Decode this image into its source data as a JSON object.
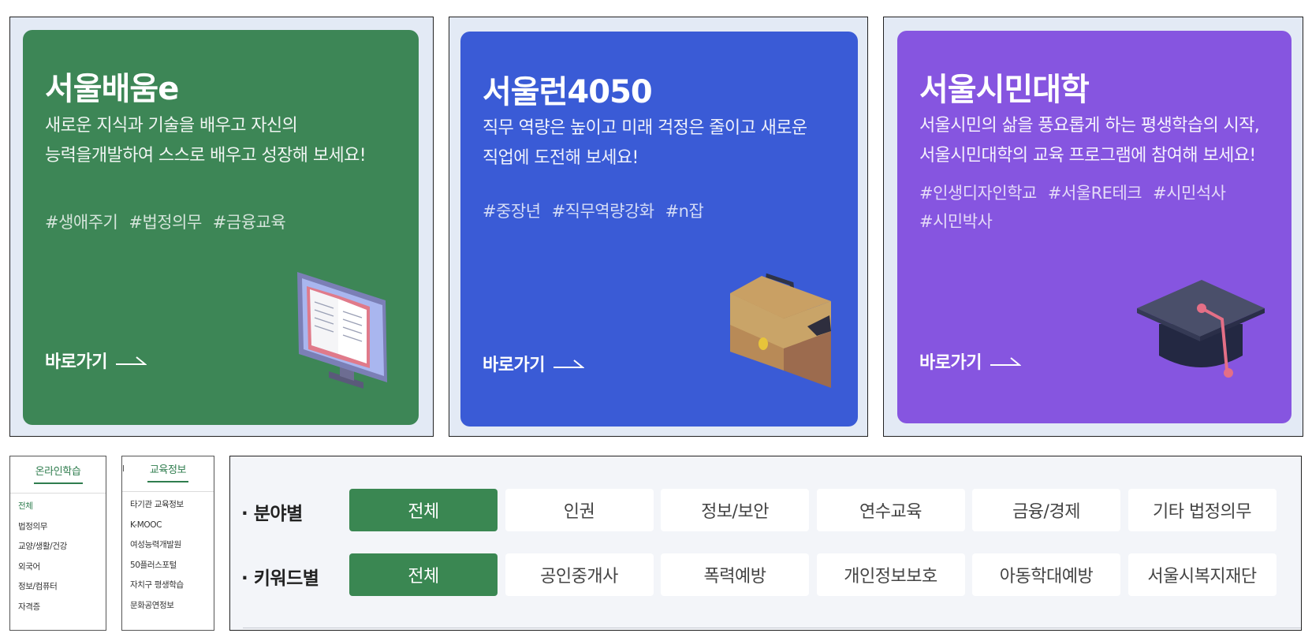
{
  "cards": [
    {
      "title": "서울배움e",
      "desc": [
        "새로운 지식과 기술을 배우고 자신의",
        "능력을개발하여 스스로 배우고 성장해 보세요!"
      ],
      "tags": [
        "#생애주기",
        "#법정의무",
        "#금융교육"
      ],
      "link": "바로가기",
      "illustration": "monitor-book-icon",
      "color": "#3d8656"
    },
    {
      "title": "서울런4050",
      "desc": [
        "직무 역량은 높이고 미래 걱정은 줄이고 새로운",
        "직업에 도전해 보세요!"
      ],
      "tags": [
        "#중장년",
        "#직무역량강화",
        "#n잡"
      ],
      "link": "바로가기",
      "illustration": "briefcase-icon",
      "color": "#3a5bd6"
    },
    {
      "title": "서울시민대학",
      "desc": [
        "서울시민의 삶을 풍요롭게 하는 평생학습의 시작,",
        "서울시민대학의 교육 프로그램에 참여해 보세요!"
      ],
      "tags": [
        "#인생디자인학교",
        "#서울RE테크",
        "#시민석사"
      ],
      "tags2": [
        "#시민박사"
      ],
      "link": "바로가기",
      "illustration": "graduation-cap-icon",
      "color": "#8655e0"
    }
  ],
  "menus": {
    "online": {
      "title": "온라인학습",
      "items": [
        "전체",
        "법정의무",
        "교양/생활/건강",
        "외국어",
        "정보/컴퓨터",
        "자격증"
      ],
      "active": "전체"
    },
    "edu": {
      "title": "교육정보",
      "items": [
        "타기관 교육정보",
        "K-MOOC",
        "여성능력개발원",
        "50플러스포털",
        "자치구 평생학습",
        "문화공연정보"
      ]
    }
  },
  "filters": {
    "field": {
      "label": "· 분야별",
      "options": [
        "전체",
        "인권",
        "정보/보안",
        "연수교육",
        "금융/경제",
        "기타 법정의무"
      ],
      "selected": "전체"
    },
    "keyword": {
      "label": "· 키워드별",
      "options": [
        "전체",
        "공인중개사",
        "폭력예방",
        "개인정보보호",
        "아동학대예방",
        "서울시복지재단"
      ],
      "selected": "전체"
    }
  },
  "colors": {
    "green": "#3d8656",
    "blue": "#3a5bd6",
    "purple": "#8655e0",
    "chip_active": "#3a8752"
  }
}
